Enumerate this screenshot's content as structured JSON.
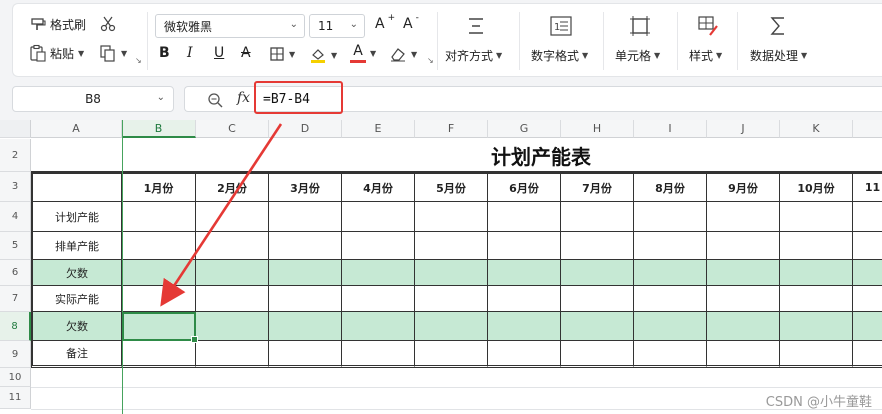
{
  "ribbon": {
    "clipboard": {
      "format_painter": "格式刷",
      "paste": "粘贴"
    },
    "font": {
      "name": "微软雅黑",
      "size": "11",
      "bold_glyph": "B",
      "italic_glyph": "I",
      "underline_glyph": "U",
      "strike_glyph": "A",
      "grow_glyph": "A",
      "shrink_glyph": "A",
      "font_color_glyph": "A",
      "highlight_color": "#f5d000",
      "font_color": "#e53935"
    },
    "groups": {
      "align": "对齐方式",
      "number_format": "数字格式",
      "cells": "单元格",
      "styles": "样式",
      "data": "数据处理"
    }
  },
  "formula_bar": {
    "cell_ref": "B8",
    "fx_label": "fx",
    "formula": "=B7-B4",
    "highlight_color": "#e53935"
  },
  "sheet": {
    "columns": [
      "A",
      "B",
      "C",
      "D",
      "E",
      "F",
      "G",
      "H",
      "I",
      "J",
      "K",
      ""
    ],
    "rows": [
      "2",
      "3",
      "4",
      "5",
      "6",
      "7",
      "8",
      "9",
      "10",
      "11"
    ],
    "title": "计划产能表",
    "header_row": [
      "",
      "1月份",
      "2月份",
      "3月份",
      "4月份",
      "5月份",
      "6月份",
      "7月份",
      "8月份",
      "9月份",
      "10月份",
      "11"
    ],
    "row_labels": [
      "计划产能",
      "排单产能",
      "欠数",
      "实际产能",
      "欠数",
      "备注"
    ],
    "green_fill": "#c6e9d4",
    "active_cell": "B8",
    "annotation_color": "#e53935"
  },
  "watermark": "CSDN @小牛童鞋"
}
